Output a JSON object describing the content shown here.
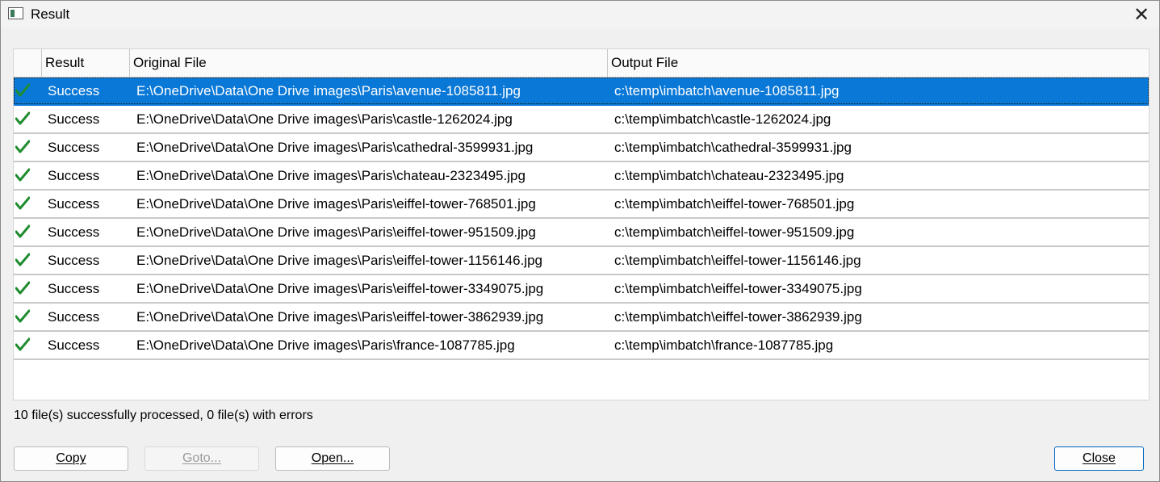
{
  "window": {
    "title": "Result"
  },
  "table": {
    "columns": [
      "",
      "Result",
      "Original File",
      "Output File"
    ],
    "rows": [
      {
        "result": "Success",
        "original": "E:\\OneDrive\\Data\\One Drive images\\Paris\\avenue-1085811.jpg",
        "output": "c:\\temp\\imbatch\\avenue-1085811.jpg",
        "selected": true
      },
      {
        "result": "Success",
        "original": "E:\\OneDrive\\Data\\One Drive images\\Paris\\castle-1262024.jpg",
        "output": "c:\\temp\\imbatch\\castle-1262024.jpg"
      },
      {
        "result": "Success",
        "original": "E:\\OneDrive\\Data\\One Drive images\\Paris\\cathedral-3599931.jpg",
        "output": "c:\\temp\\imbatch\\cathedral-3599931.jpg"
      },
      {
        "result": "Success",
        "original": "E:\\OneDrive\\Data\\One Drive images\\Paris\\chateau-2323495.jpg",
        "output": "c:\\temp\\imbatch\\chateau-2323495.jpg"
      },
      {
        "result": "Success",
        "original": "E:\\OneDrive\\Data\\One Drive images\\Paris\\eiffel-tower-768501.jpg",
        "output": "c:\\temp\\imbatch\\eiffel-tower-768501.jpg"
      },
      {
        "result": "Success",
        "original": "E:\\OneDrive\\Data\\One Drive images\\Paris\\eiffel-tower-951509.jpg",
        "output": "c:\\temp\\imbatch\\eiffel-tower-951509.jpg"
      },
      {
        "result": "Success",
        "original": "E:\\OneDrive\\Data\\One Drive images\\Paris\\eiffel-tower-1156146.jpg",
        "output": "c:\\temp\\imbatch\\eiffel-tower-1156146.jpg"
      },
      {
        "result": "Success",
        "original": "E:\\OneDrive\\Data\\One Drive images\\Paris\\eiffel-tower-3349075.jpg",
        "output": "c:\\temp\\imbatch\\eiffel-tower-3349075.jpg"
      },
      {
        "result": "Success",
        "original": "E:\\OneDrive\\Data\\One Drive images\\Paris\\eiffel-tower-3862939.jpg",
        "output": "c:\\temp\\imbatch\\eiffel-tower-3862939.jpg"
      },
      {
        "result": "Success",
        "original": "E:\\OneDrive\\Data\\One Drive images\\Paris\\france-1087785.jpg",
        "output": "c:\\temp\\imbatch\\france-1087785.jpg"
      }
    ],
    "row_icon": "green-checkmark-icon"
  },
  "status": {
    "summary": "10 file(s) successfully processed, 0 file(s) with errors"
  },
  "buttons": {
    "copy": "Copy",
    "goto": "Goto...",
    "open": "Open...",
    "close": "Close"
  },
  "colors": {
    "selection": "#0a78d7",
    "check": "#1e8c2e",
    "default_button_border": "#0067c0"
  }
}
